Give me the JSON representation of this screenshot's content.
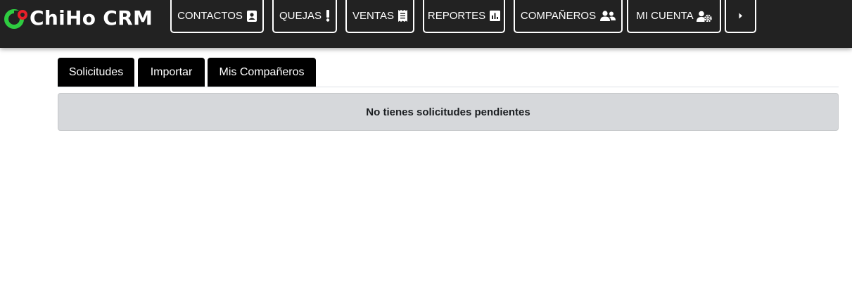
{
  "app": {
    "brand": "ChiHo CRM"
  },
  "nav": {
    "contactos": {
      "label": "CONTACTOS",
      "icon": "address-book-icon"
    },
    "quejas": {
      "label": "QUEJAS",
      "icon": "exclamation-icon"
    },
    "ventas": {
      "label": "VENTAS",
      "icon": "receipt-icon"
    },
    "reportes": {
      "label": "REPORTES",
      "icon": "chart-icon"
    },
    "companeros": {
      "label": "COMPAÑEROS",
      "icon": "user-friends-icon"
    },
    "cuenta": {
      "label": "MI CUENTA",
      "icon": "user-cog-icon"
    },
    "more": {
      "label": "",
      "icon": "caret-right-icon"
    }
  },
  "tabs": {
    "solicitudes": "Solicitudes",
    "importar": "Importar",
    "companeros": "Mis Compañeros"
  },
  "alert": {
    "message": "No tienes solicitudes pendientes"
  },
  "colors": {
    "topbar": "#222222",
    "logo_green": "#2ecc40",
    "logo_red": "#e8202a",
    "tab_bg": "#000000",
    "alert_bg": "#d6d8db"
  }
}
